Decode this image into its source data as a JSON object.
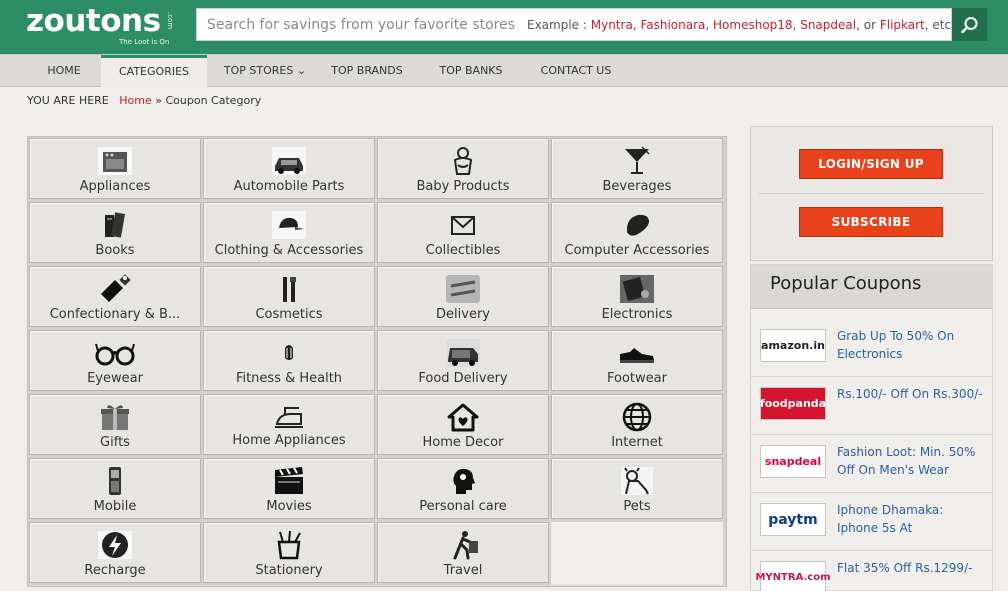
{
  "header": {
    "logo_text": "zoutons",
    "logo_com": ".com",
    "logo_tagline": "The Loot is On",
    "search_placeholder": "Search for savings from your favorite stores",
    "example_prefix": "Example :",
    "example_stores": [
      "Myntra",
      "Fashionara",
      "Homeshop18",
      "Snapdeal"
    ],
    "example_or": "or",
    "example_last": "Flipkart",
    "example_suffix": "etc....",
    "brand_color": "#2d8d67"
  },
  "nav": {
    "items": [
      {
        "label": "HOME"
      },
      {
        "label": "CATEGORIES"
      },
      {
        "label": "TOP STORES"
      },
      {
        "label": "TOP BRANDS"
      },
      {
        "label": "TOP BANKS"
      },
      {
        "label": "CONTACT US"
      }
    ],
    "active": "CATEGORIES"
  },
  "breadcrumb": {
    "prefix": "YOU ARE HERE",
    "home": "Home",
    "sep": "»",
    "current": "Coupon Category"
  },
  "categories": [
    {
      "label": "Appliances",
      "icon": "appliance-icon"
    },
    {
      "label": "Automobile Parts",
      "icon": "car-icon"
    },
    {
      "label": "Baby Products",
      "icon": "baby-icon"
    },
    {
      "label": "Beverages",
      "icon": "cocktail-icon"
    },
    {
      "label": "Books",
      "icon": "books-icon"
    },
    {
      "label": "Clothing & Accessories",
      "icon": "cap-icon"
    },
    {
      "label": "Collectibles",
      "icon": "envelope-icon"
    },
    {
      "label": "Computer Accessories",
      "icon": "mouse-icon"
    },
    {
      "label": "Confectionary & B...",
      "icon": "candy-icon"
    },
    {
      "label": "Cosmetics",
      "icon": "cosmetics-icon"
    },
    {
      "label": "Delivery",
      "icon": "free-delivery-icon"
    },
    {
      "label": "Electronics",
      "icon": "electronics-icon"
    },
    {
      "label": "Eyewear",
      "icon": "glasses-icon"
    },
    {
      "label": "Fitness & Health",
      "icon": "fitness-icon"
    },
    {
      "label": "Food Delivery",
      "icon": "food-delivery-icon"
    },
    {
      "label": "Footwear",
      "icon": "shoe-icon"
    },
    {
      "label": "Gifts",
      "icon": "gift-icon"
    },
    {
      "label": "Home Appliances",
      "icon": "iron-icon"
    },
    {
      "label": "Home Decor",
      "icon": "house-icon"
    },
    {
      "label": "Internet",
      "icon": "globe-icon"
    },
    {
      "label": "Mobile",
      "icon": "phone-icon"
    },
    {
      "label": "Movies",
      "icon": "clapperboard-icon"
    },
    {
      "label": "Personal care",
      "icon": "head-icon"
    },
    {
      "label": "Pets",
      "icon": "pet-icon"
    },
    {
      "label": "Recharge",
      "icon": "lightning-icon"
    },
    {
      "label": "Stationery",
      "icon": "pen-holder-icon"
    },
    {
      "label": "Travel",
      "icon": "traveller-icon"
    }
  ],
  "sidebar": {
    "login_label": "LOGIN/SIGN UP",
    "subscribe_label": "SUBSCRIBE",
    "popular_title": "Popular Coupons",
    "coupons": [
      {
        "store": "amazon.in",
        "text": "Grab Up To 50% On Electronics"
      },
      {
        "store": "foodpanda",
        "text": "Rs.100/- Off On Rs.300/-"
      },
      {
        "store": "snapdeal",
        "text": "Fashion Loot: Min. 50% Off On Men's Wear"
      },
      {
        "store": "paytm",
        "text": "Iphone Dhamaka: Iphone 5s At"
      },
      {
        "store": "MYNTRA.com",
        "text": "Flat 35% Off Rs.1299/-"
      }
    ]
  }
}
